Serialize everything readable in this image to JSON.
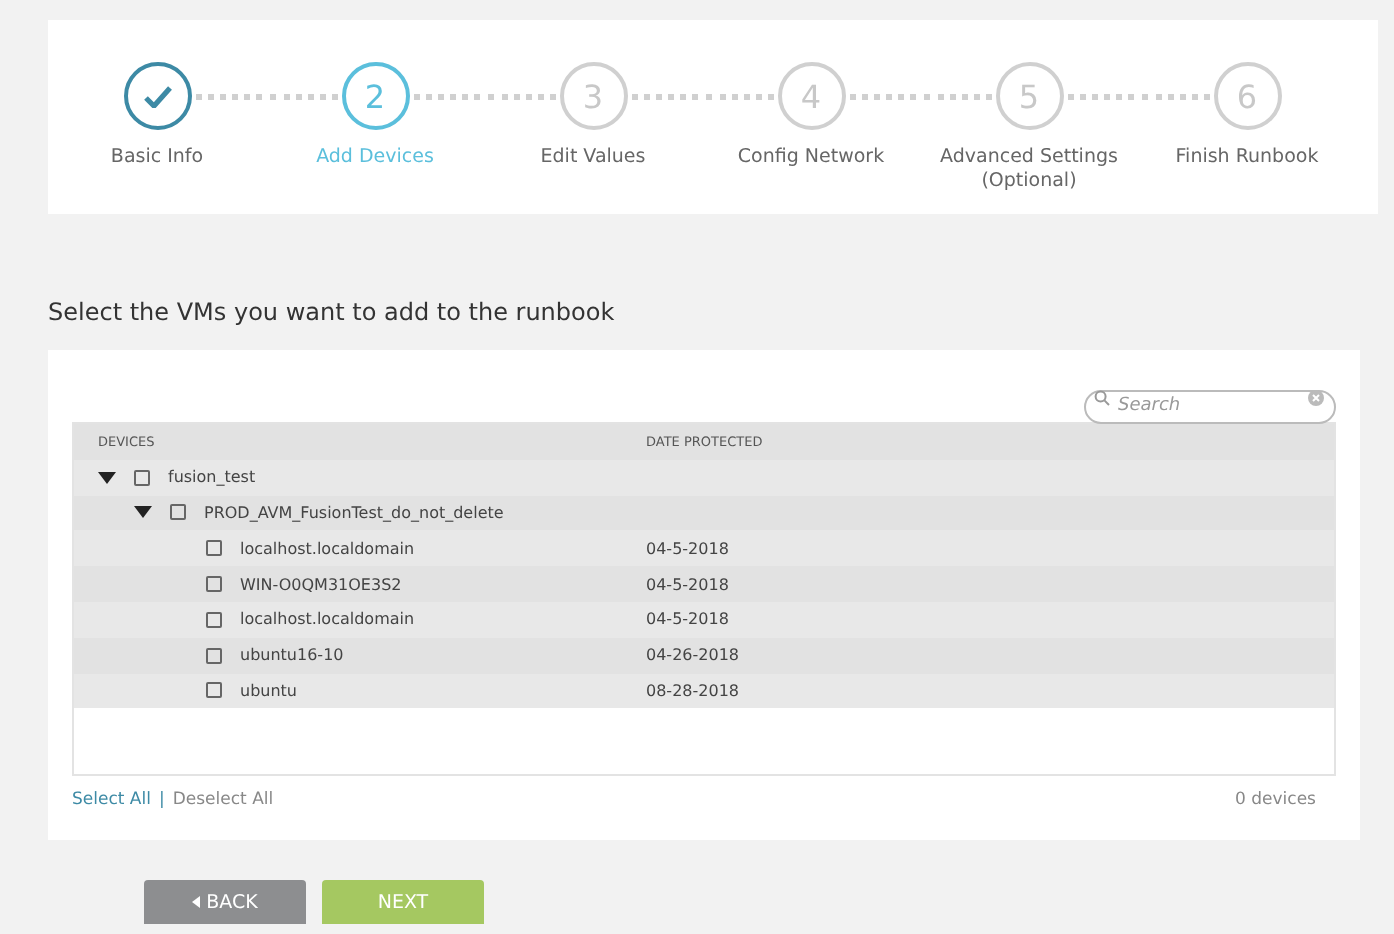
{
  "steps": [
    {
      "label": "Basic Info",
      "done": true,
      "selected": false
    },
    {
      "label": "Add Devices",
      "number": "2",
      "done": false,
      "selected": true
    },
    {
      "label": "Edit Values",
      "number": "3",
      "done": false,
      "selected": false
    },
    {
      "label": "Config Network",
      "number": "4",
      "done": false,
      "selected": false
    },
    {
      "label": "Advanced Settings (Optional)",
      "number": "5",
      "done": false,
      "selected": false
    },
    {
      "label": "Finish Runbook",
      "number": "6",
      "done": false,
      "selected": false
    }
  ],
  "heading": "Select the VMs you want to add to the runbook",
  "search": {
    "placeholder": "Search"
  },
  "table": {
    "columns": [
      "DEVICES",
      "DATE PROTECTED"
    ],
    "rows": [
      {
        "name": "fusion_test",
        "checked": false,
        "expanded": true,
        "children": [
          {
            "name": "PROD_AVM_FusionTest_do_not_delete",
            "checked": false,
            "expanded": true,
            "children": [
              {
                "name": "localhost.localdomain",
                "date": "04-5-2018",
                "checked": false
              },
              {
                "name": "WIN-O0QM31OE3S2",
                "date": "04-5-2018",
                "checked": false
              },
              {
                "name": "localhost.localdomain",
                "date": "04-5-2018",
                "checked": false
              },
              {
                "name": "ubuntu16-10",
                "date": "04-26-2018",
                "checked": false
              },
              {
                "name": "ubuntu",
                "date": "08-28-2018",
                "checked": false
              }
            ]
          }
        ]
      }
    ]
  },
  "footer": {
    "select_all": "Select All",
    "separator": "|",
    "deselect_all": "Deselect All",
    "count": "0 devices"
  },
  "buttons": [
    {
      "label": "BACK",
      "kind": "back"
    },
    {
      "label": "NEXT",
      "kind": "next"
    }
  ]
}
